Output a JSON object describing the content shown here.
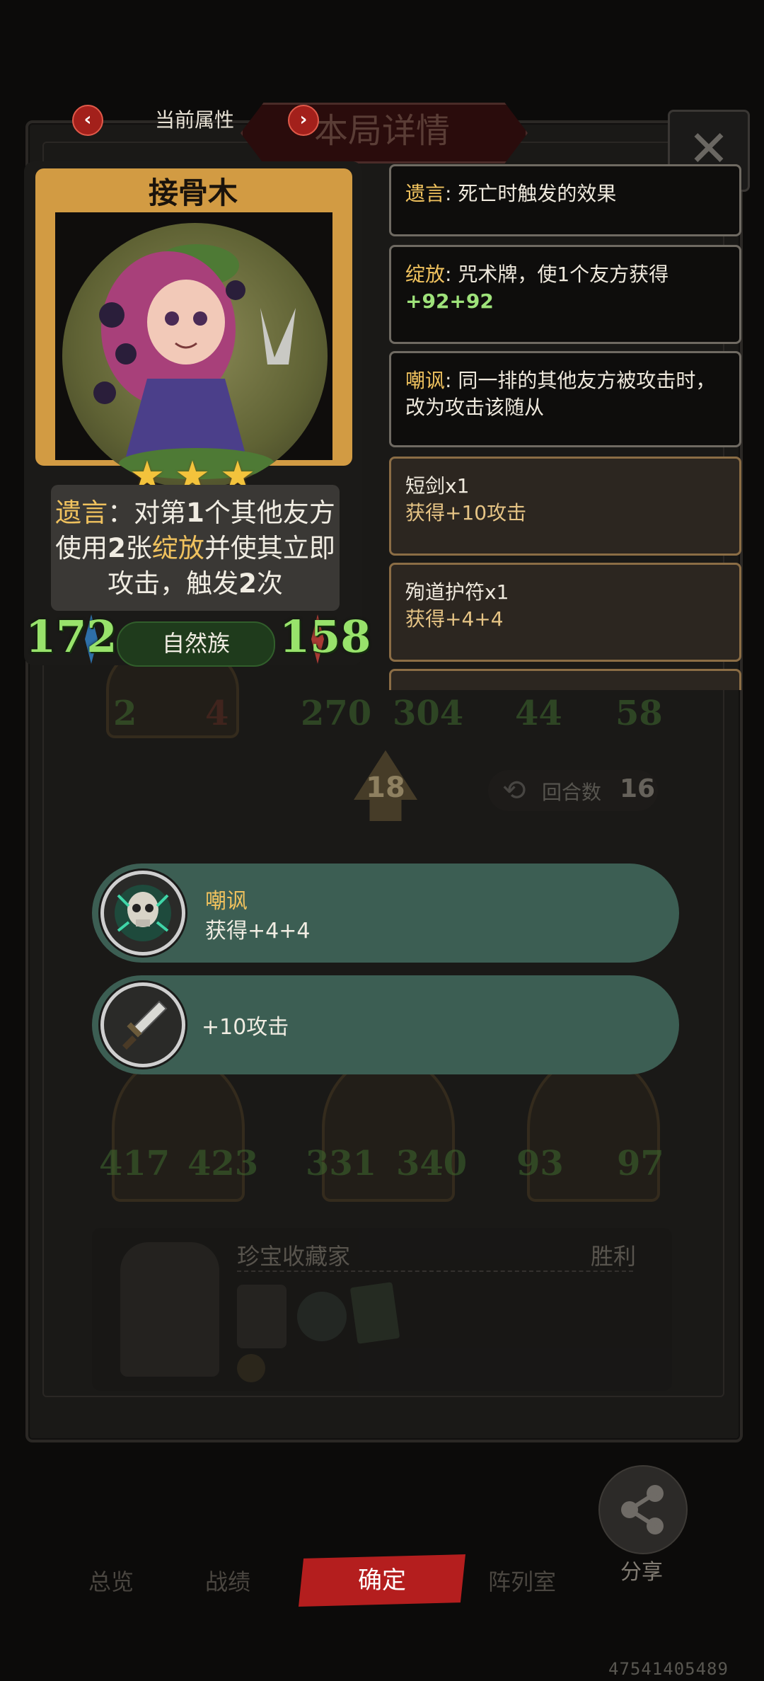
{
  "header": {
    "prev_arrow": "‹",
    "next_arrow": "›",
    "attr_label": "当前属性",
    "title": "本局详情",
    "close": "✕"
  },
  "card": {
    "name": "接骨木",
    "stars": 3,
    "desc_kw1": "遗言",
    "desc_p1": "：对第",
    "desc_n1": "1",
    "desc_p2": "个其他友方使用",
    "desc_n2": "2",
    "desc_p3": "张",
    "desc_kw2": "绽放",
    "desc_p4": "并使其立即攻击，触发",
    "desc_n3": "2",
    "desc_p5": "次",
    "tribe": "自然族",
    "attack": "172",
    "health": "158"
  },
  "keywords": [
    {
      "name": "遗言",
      "sep": ": ",
      "text": "死亡时触发的效果",
      "extra": ""
    },
    {
      "name": "绽放",
      "sep": ": ",
      "text": "咒术牌，使1个友方获得",
      "extra": "+92+92"
    },
    {
      "name": "嘲讽",
      "sep": ": ",
      "text": "同一排的其他友方被攻击时，改为攻击该随从",
      "extra": ""
    }
  ],
  "items": [
    {
      "name": "短剑x1",
      "effect": "获得+10攻击"
    },
    {
      "name": "殉道护符x1",
      "effect": "获得+4+4"
    }
  ],
  "board": {
    "row1": [
      {
        "atk": "2",
        "hp": "4"
      },
      {
        "atk": "270",
        "hp": "304"
      },
      {
        "atk": "44",
        "hp": "58"
      }
    ],
    "tier": "18",
    "round_label": "回合数",
    "round_value": "16",
    "row2": [
      {
        "atk": "417",
        "hp": "423"
      },
      {
        "atk": "331",
        "hp": "340"
      },
      {
        "atk": "93",
        "hp": "97"
      }
    ],
    "collector_name": "珍宝收藏家",
    "result": "胜利"
  },
  "popups": [
    {
      "title": "嘲讽",
      "text": "获得+4+4",
      "icon": "skull-taunt-icon"
    },
    {
      "title": "",
      "text": "+10攻击",
      "icon": "dagger-icon"
    }
  ],
  "bottom": {
    "tabs": [
      "总览",
      "战绩",
      "阵列室"
    ],
    "confirm": "确定",
    "share": "分享",
    "uid": "47541405489"
  },
  "colors": {
    "keyword_yellow": "#f0c25e",
    "stat_green": "#98e26b",
    "confirm_red": "#b41e1e",
    "popup_teal": "#3c5e53"
  }
}
